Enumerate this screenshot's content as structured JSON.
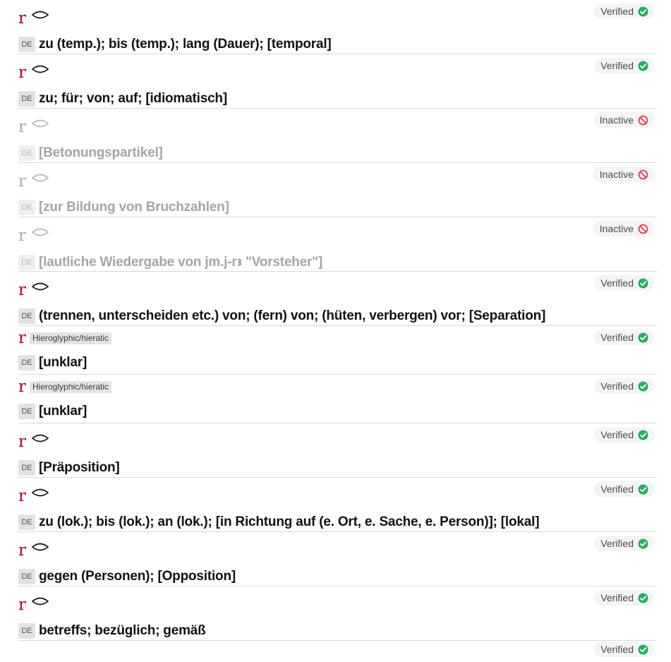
{
  "entries": [
    {
      "id": "e1",
      "lemma": "r",
      "script_label": "",
      "status": "Verified",
      "lang": "DE",
      "translation": "zu (temp.); bis (temp.); lang (Dauer); [temporal]"
    },
    {
      "id": "e2",
      "lemma": "r",
      "script_label": "",
      "status": "Verified",
      "lang": "DE",
      "translation": "zu; für; von; auf; [idiomatisch]"
    },
    {
      "id": "e3",
      "lemma": "r",
      "script_label": "",
      "status": "Inactive",
      "lang": "DE",
      "translation": "[Betonungspartikel]"
    },
    {
      "id": "e4",
      "lemma": "r",
      "script_label": "",
      "status": "Inactive",
      "lang": "DE",
      "translation": "[zur Bildung von Bruchzahlen]"
    },
    {
      "id": "e5",
      "lemma": "r",
      "script_label": "",
      "status": "Inactive",
      "lang": "DE",
      "translation": "[lautliche Wiedergabe von jm.j-rꜣ \"Vorsteher\"]"
    },
    {
      "id": "e6",
      "lemma": "r",
      "script_label": "",
      "status": "Verified",
      "lang": "DE",
      "translation": "(trennen, unterscheiden etc.) von; (fern) von; (hüten, verbergen) vor; [Separation]"
    },
    {
      "id": "e7",
      "lemma": "r",
      "script_label": "Hieroglyphic/hieratic",
      "status": "Verified",
      "lang": "DE",
      "translation": "[unklar]"
    },
    {
      "id": "e8",
      "lemma": "r",
      "script_label": "Hieroglyphic/hieratic",
      "status": "Verified",
      "lang": "DE",
      "translation": "[unklar]"
    },
    {
      "id": "e9",
      "lemma": "r",
      "script_label": "",
      "status": "Verified",
      "lang": "DE",
      "translation": "[Präposition]"
    },
    {
      "id": "e10",
      "lemma": "r",
      "script_label": "",
      "status": "Verified",
      "lang": "DE",
      "translation": "zu (lok.); bis (lok.); an (lok.); [in Richtung auf (e. Ort, e. Sache, e. Person)]; [lokal]"
    },
    {
      "id": "e11",
      "lemma": "r",
      "script_label": "",
      "status": "Verified",
      "lang": "DE",
      "translation": "gegen (Personen); [Opposition]"
    },
    {
      "id": "e12",
      "lemma": "r",
      "script_label": "",
      "status": "Verified",
      "lang": "DE",
      "translation": "betreffs; bezüglich; gemäß"
    },
    {
      "id": "e13",
      "lemma": "",
      "script_label": "",
      "status": "Verified",
      "lang": "",
      "translation": ""
    }
  ],
  "status_colors": {
    "Verified": "#27ae60",
    "Inactive": "#e0435a"
  },
  "icons": {
    "Verified": "check-circle-icon",
    "Inactive": "no-entry-icon",
    "lemma_glyph": "cartouche-icon"
  }
}
